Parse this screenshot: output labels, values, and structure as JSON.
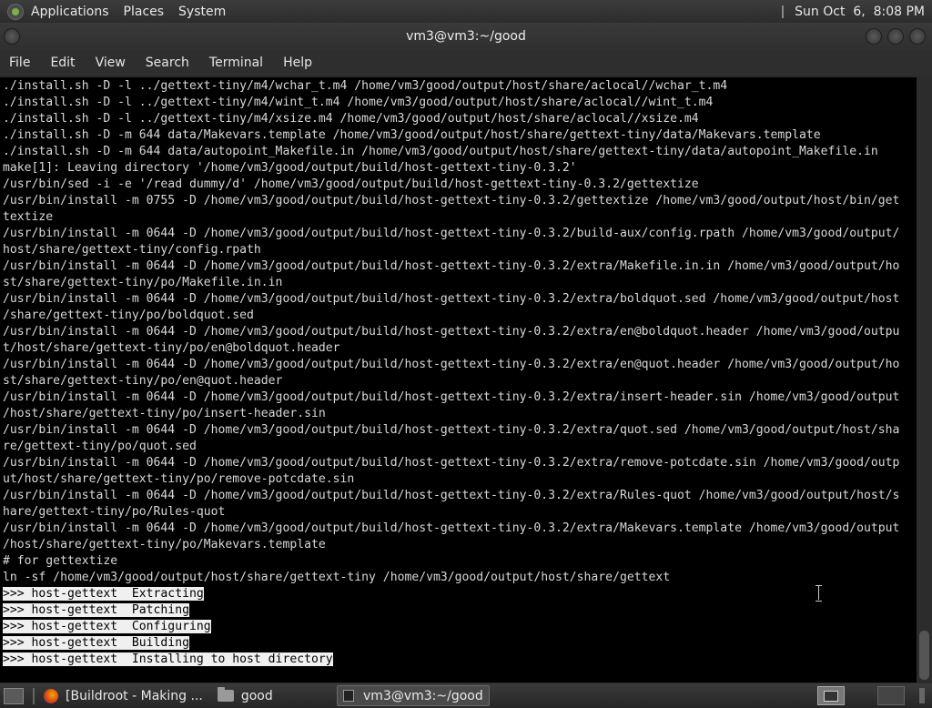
{
  "top_panel": {
    "menus": [
      "Applications",
      "Places",
      "System"
    ],
    "clock": "Sun Oct  6,  8:08 PM"
  },
  "window": {
    "title": "vm3@vm3:~/good"
  },
  "menubar": [
    "File",
    "Edit",
    "View",
    "Search",
    "Terminal",
    "Help"
  ],
  "terminal": {
    "lines": [
      "./install.sh -D -l ../gettext-tiny/m4/wchar_t.m4 /home/vm3/good/output/host/share/aclocal//wchar_t.m4",
      "./install.sh -D -l ../gettext-tiny/m4/wint_t.m4 /home/vm3/good/output/host/share/aclocal//wint_t.m4",
      "./install.sh -D -l ../gettext-tiny/m4/xsize.m4 /home/vm3/good/output/host/share/aclocal//xsize.m4",
      "./install.sh -D -m 644 data/Makevars.template /home/vm3/good/output/host/share/gettext-tiny/data/Makevars.template",
      "./install.sh -D -m 644 data/autopoint_Makefile.in /home/vm3/good/output/host/share/gettext-tiny/data/autopoint_Makefile.in",
      "make[1]: Leaving directory '/home/vm3/good/output/build/host-gettext-tiny-0.3.2'",
      "/usr/bin/sed -i -e '/read dummy/d' /home/vm3/good/output/build/host-gettext-tiny-0.3.2/gettextize",
      "/usr/bin/install -m 0755 -D /home/vm3/good/output/build/host-gettext-tiny-0.3.2/gettextize /home/vm3/good/output/host/bin/get",
      "textize",
      "/usr/bin/install -m 0644 -D /home/vm3/good/output/build/host-gettext-tiny-0.3.2/build-aux/config.rpath /home/vm3/good/output/",
      "host/share/gettext-tiny/config.rpath",
      "/usr/bin/install -m 0644 -D /home/vm3/good/output/build/host-gettext-tiny-0.3.2/extra/Makefile.in.in /home/vm3/good/output/ho",
      "st/share/gettext-tiny/po/Makefile.in.in",
      "/usr/bin/install -m 0644 -D /home/vm3/good/output/build/host-gettext-tiny-0.3.2/extra/boldquot.sed /home/vm3/good/output/host",
      "/share/gettext-tiny/po/boldquot.sed",
      "/usr/bin/install -m 0644 -D /home/vm3/good/output/build/host-gettext-tiny-0.3.2/extra/en@boldquot.header /home/vm3/good/outpu",
      "t/host/share/gettext-tiny/po/en@boldquot.header",
      "/usr/bin/install -m 0644 -D /home/vm3/good/output/build/host-gettext-tiny-0.3.2/extra/en@quot.header /home/vm3/good/output/ho",
      "st/share/gettext-tiny/po/en@quot.header",
      "/usr/bin/install -m 0644 -D /home/vm3/good/output/build/host-gettext-tiny-0.3.2/extra/insert-header.sin /home/vm3/good/output",
      "/host/share/gettext-tiny/po/insert-header.sin",
      "/usr/bin/install -m 0644 -D /home/vm3/good/output/build/host-gettext-tiny-0.3.2/extra/quot.sed /home/vm3/good/output/host/sha",
      "re/gettext-tiny/po/quot.sed",
      "/usr/bin/install -m 0644 -D /home/vm3/good/output/build/host-gettext-tiny-0.3.2/extra/remove-potcdate.sin /home/vm3/good/outp",
      "ut/host/share/gettext-tiny/po/remove-potcdate.sin",
      "/usr/bin/install -m 0644 -D /home/vm3/good/output/build/host-gettext-tiny-0.3.2/extra/Rules-quot /home/vm3/good/output/host/s",
      "hare/gettext-tiny/po/Rules-quot",
      "/usr/bin/install -m 0644 -D /home/vm3/good/output/build/host-gettext-tiny-0.3.2/extra/Makevars.template /home/vm3/good/output",
      "/host/share/gettext-tiny/po/Makevars.template",
      "# for gettextize",
      "ln -sf /home/vm3/good/output/host/share/gettext-tiny /home/vm3/good/output/host/share/gettext"
    ],
    "highlighted_lines": [
      ">>> host-gettext  Extracting",
      ">>> host-gettext  Patching",
      ">>> host-gettext  Configuring",
      ">>> host-gettext  Building",
      ">>> host-gettext  Installing to host directory"
    ]
  },
  "taskbar": {
    "items": [
      {
        "label": "[Buildroot - Making ...",
        "icon": "firefox-icon",
        "active": false
      },
      {
        "label": "good",
        "icon": "folder-icon",
        "active": false
      },
      {
        "label": "vm3@vm3:~/good",
        "icon": "terminal-icon",
        "active": true
      }
    ]
  }
}
